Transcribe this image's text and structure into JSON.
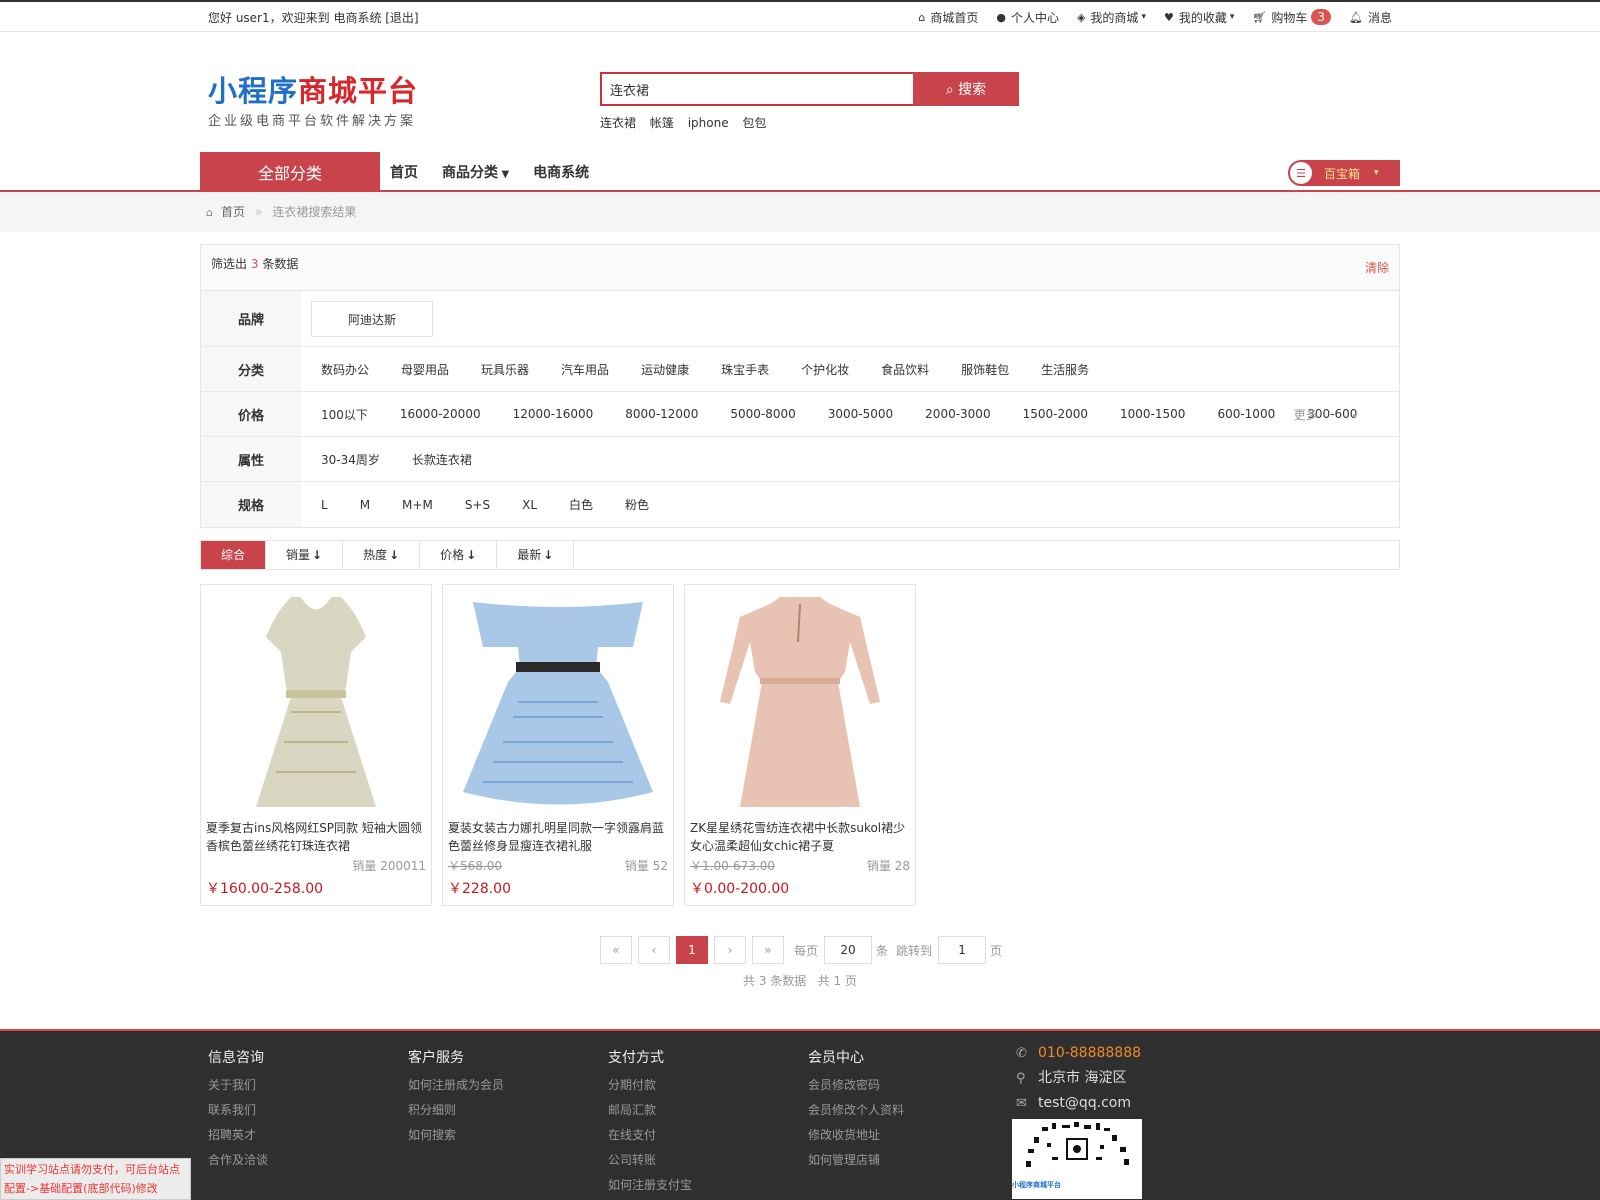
{
  "topbar": {
    "greeting": "您好 user1，欢迎来到 电商系统 [退出]",
    "links": {
      "home": "商城首页",
      "personal": "个人中心",
      "mystore": "我的商城",
      "favorites": "我的收藏",
      "cart": "购物车",
      "cart_count": "3",
      "messages": "消息"
    }
  },
  "logo": {
    "part1": "小程序",
    "part2": "商城平台",
    "slogan": "企业级电商平台软件解决方案"
  },
  "search": {
    "value": "连衣裙",
    "button": "搜索",
    "hot": [
      "连衣裙",
      "帐篷",
      "iphone",
      "包包"
    ]
  },
  "nav": {
    "all_categories": "全部分类",
    "links": [
      "首页",
      "商品分类",
      "电商系统"
    ],
    "treasure_box": "百宝箱"
  },
  "breadcrumb": {
    "home": "首页",
    "separator": "»",
    "current": "连衣裙搜索结果"
  },
  "filter": {
    "count_prefix": "筛选出",
    "count": "3",
    "count_suffix": "条数据",
    "clear": "清除",
    "rows": {
      "brand": {
        "label": "品牌",
        "options": [
          "阿迪达斯"
        ]
      },
      "category": {
        "label": "分类",
        "options": [
          "数码办公",
          "母婴用品",
          "玩具乐器",
          "汽车用品",
          "运动健康",
          "珠宝手表",
          "个护化妆",
          "食品饮料",
          "服饰鞋包",
          "生活服务"
        ]
      },
      "price": {
        "label": "价格",
        "options": [
          "100以下",
          "16000-20000",
          "12000-16000",
          "8000-12000",
          "5000-8000",
          "3000-5000",
          "2000-3000",
          "1500-2000",
          "1000-1500",
          "600-1000",
          "300-600"
        ],
        "more": "更多"
      },
      "attribute": {
        "label": "属性",
        "options": [
          "30-34周岁",
          "长款连衣裙"
        ]
      },
      "spec": {
        "label": "规格",
        "options": [
          "L",
          "M",
          "M+M",
          "S+S",
          "XL",
          "白色",
          "粉色"
        ]
      }
    }
  },
  "sort": {
    "items": [
      "综合",
      "销量",
      "热度",
      "价格",
      "最新"
    ],
    "arrow": "↓"
  },
  "products": [
    {
      "title": "夏季复古ins风格网红SP同款 短袖大圆领香槟色蕾丝绣花钉珠连衣裙",
      "original_price": "",
      "sales": "销量 200011",
      "price": "￥160.00-258.00",
      "colors": {
        "main": "#d9d6c2",
        "accent": "#c7c39c"
      }
    },
    {
      "title": "夏装女装古力娜扎明星同款一字领露肩蓝色蕾丝修身显瘦连衣裙礼服",
      "original_price": "￥568.00",
      "sales": "销量 52",
      "price": "￥228.00",
      "colors": {
        "main": "#a9c8e8",
        "accent": "#7aa6d6"
      }
    },
    {
      "title": "ZK星星绣花雪纺连衣裙中长款sukol裙少女心温柔超仙女chic裙子夏",
      "original_price": "￥1.00-673.00",
      "sales": "销量 28",
      "price": "￥0.00-200.00",
      "colors": {
        "main": "#e8c3b4",
        "accent": "#d9a999"
      }
    }
  ],
  "pager": {
    "first": "«",
    "prev": "‹",
    "current": "1",
    "next": "›",
    "last": "»",
    "per_page_label": "每页",
    "per_page_value": "20",
    "per_page_unit": "条",
    "jump_label": "跳转到",
    "jump_value": "1",
    "jump_unit": "页",
    "summary": "共 3 条数据   共 1 页"
  },
  "footer": {
    "columns": [
      {
        "title": "信息咨询",
        "links": [
          "关于我们",
          "联系我们",
          "招聘英才",
          "合作及洽谈"
        ]
      },
      {
        "title": "客户服务",
        "links": [
          "如何注册成为会员",
          "积分细则",
          "如何搜索"
        ]
      },
      {
        "title": "支付方式",
        "links": [
          "分期付款",
          "邮局汇款",
          "在线支付",
          "公司转账",
          "如何注册支付宝"
        ]
      },
      {
        "title": "会员中心",
        "links": [
          "会员修改密码",
          "会员修改个人资料",
          "修改收货地址",
          "如何管理店铺"
        ]
      }
    ],
    "contact": {
      "phone": "010-88888888",
      "address": "北京市 海淀区",
      "email": "test@qq.com"
    },
    "qr_text": "小程序商城平台",
    "notice": "实训学习站点请勿支付，可后台站点配置->基础配置(底部代码)修改"
  },
  "theme": {
    "primary": "#c9434b",
    "price": "#c9171e",
    "footer_bg": "#2f2f2f"
  }
}
